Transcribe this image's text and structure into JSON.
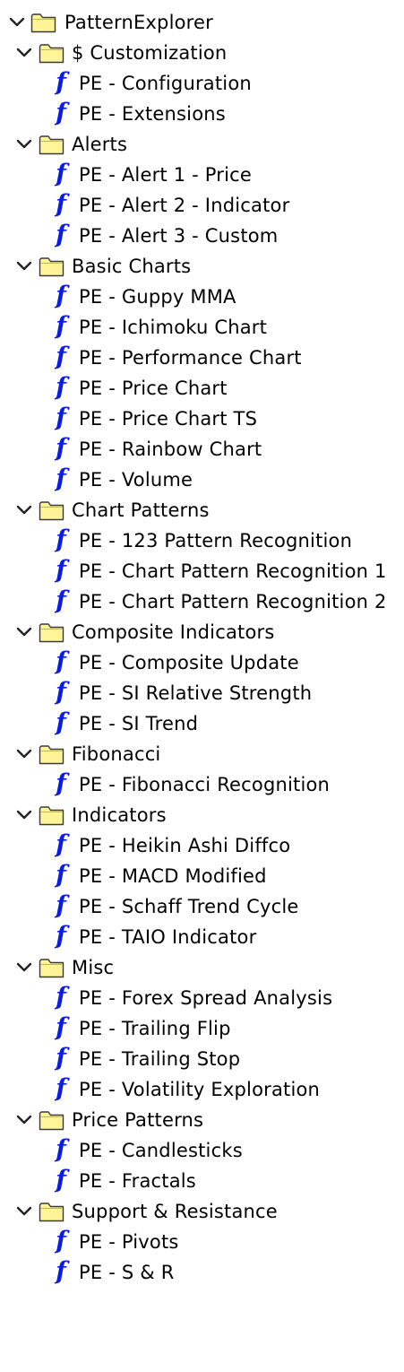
{
  "root": {
    "label": "PatternExplorer",
    "icon": "folder-icon"
  },
  "groups": [
    {
      "label": "$ Customization",
      "items": [
        "PE - Configuration",
        "PE - Extensions"
      ]
    },
    {
      "label": "Alerts",
      "items": [
        "PE - Alert 1 - Price",
        "PE - Alert 2 - Indicator",
        "PE - Alert 3 - Custom"
      ]
    },
    {
      "label": "Basic Charts",
      "items": [
        "PE - Guppy MMA",
        "PE - Ichimoku Chart",
        "PE - Performance Chart",
        "PE - Price Chart",
        "PE - Price Chart TS",
        "PE - Rainbow Chart",
        "PE - Volume"
      ]
    },
    {
      "label": "Chart Patterns",
      "items": [
        "PE - 123 Pattern Recognition",
        "PE - Chart Pattern Recognition 1",
        "PE - Chart Pattern Recognition 2"
      ]
    },
    {
      "label": "Composite Indicators",
      "items": [
        "PE - Composite Update",
        "PE - SI Relative Strength",
        "PE - SI Trend"
      ]
    },
    {
      "label": "Fibonacci",
      "items": [
        "PE - Fibonacci Recognition"
      ]
    },
    {
      "label": "Indicators",
      "items": [
        "PE - Heikin Ashi Diffco",
        "PE - MACD Modified",
        "PE - Schaff Trend Cycle",
        "PE - TAIO Indicator"
      ]
    },
    {
      "label": "Misc",
      "items": [
        "PE - Forex Spread Analysis",
        "PE - Trailing Flip",
        "PE - Trailing Stop",
        "PE - Volatility Exploration"
      ]
    },
    {
      "label": "Price Patterns",
      "items": [
        "PE - Candlesticks",
        "PE - Fractals"
      ]
    },
    {
      "label": "Support & Resistance",
      "items": [
        "PE - Pivots",
        "PE - S & R"
      ]
    }
  ],
  "icons": {
    "folder": "folder-icon",
    "expander": "chevron-down-icon",
    "formula": "function-icon",
    "formula_glyph": "f"
  },
  "colors": {
    "folder_fill": "#fff598",
    "folder_stroke": "#3a3a3a",
    "formula_icon": "#0a1de0",
    "text": "#000000",
    "background": "#ffffff"
  }
}
